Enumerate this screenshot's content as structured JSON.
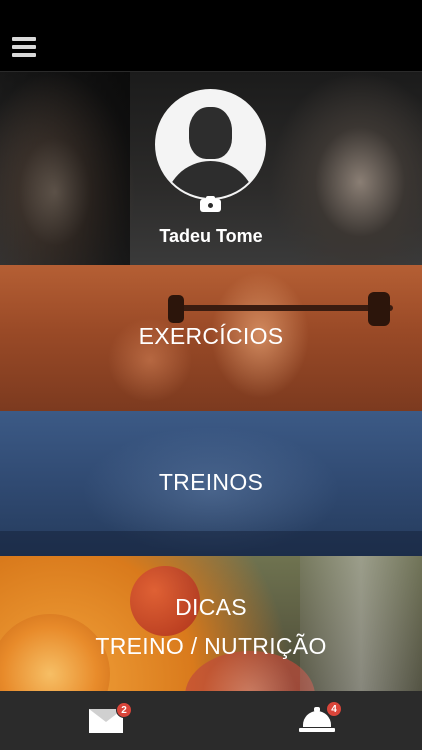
{
  "header": {
    "menu_icon": "hamburger-icon"
  },
  "profile": {
    "name": "Tadeu Tome",
    "avatar_icon": "default-avatar-icon",
    "camera_icon": "camera-icon"
  },
  "menu": {
    "exercicios": {
      "label": "EXERCÍCIOS",
      "tint": "#b55f34"
    },
    "treinos": {
      "label": "TREINOS",
      "tint": "#3c5a86"
    },
    "dicas": {
      "line1": "DICAS",
      "line2": "TREINO / NUTRIÇÃO",
      "tint": "#6f7350"
    }
  },
  "bottom_bar": {
    "messages": {
      "icon": "envelope-icon",
      "badge": "2"
    },
    "notifications": {
      "icon": "service-bell-icon",
      "badge": "4"
    },
    "badge_color": "#d9453a"
  }
}
